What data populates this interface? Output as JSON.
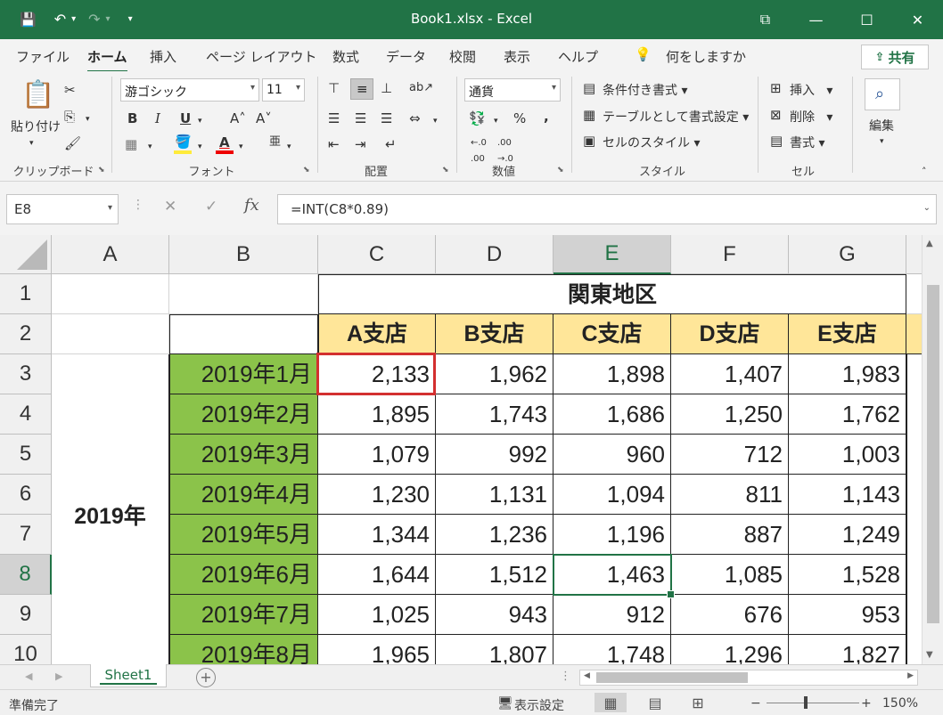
{
  "window": {
    "title": "Book1.xlsx - Excel",
    "controls": [
      "⧉",
      "—",
      "☐",
      "✕"
    ]
  },
  "qat": {
    "save": "💾",
    "undo": "↶",
    "redo": "↷",
    "more": "▾"
  },
  "tabs": [
    "ファイル",
    "ホーム",
    "挿入",
    "ページ レイアウト",
    "数式",
    "データ",
    "校閲",
    "表示",
    "ヘルプ"
  ],
  "active_tab": "ホーム",
  "tellme": "何をしますか",
  "share": "共有",
  "ribbon": {
    "clipboard": {
      "paste": "貼り付け",
      "group": "クリップボード"
    },
    "font": {
      "name": "游ゴシック",
      "size": "11",
      "bold": "B",
      "italic": "I",
      "underline": "U",
      "grow": "A˄",
      "shrink": "A˅",
      "group": "フォント"
    },
    "align": {
      "group": "配置"
    },
    "number": {
      "format": "通貨",
      "percent": "%",
      "comma": ",",
      "group": "数値"
    },
    "styles": {
      "cond": "条件付き書式",
      "table": "テーブルとして書式設定",
      "cell": "セルのスタイル",
      "group": "スタイル"
    },
    "cells": {
      "insert": "挿入",
      "delete": "削除",
      "format": "書式",
      "group": "セル"
    },
    "edit": {
      "label": "編集"
    }
  },
  "formula_bar": {
    "name_box": "E8",
    "formula": "=INT(C8*0.89)"
  },
  "columns": [
    "A",
    "B",
    "C",
    "D",
    "E",
    "F",
    "G"
  ],
  "rows": [
    "1",
    "2",
    "3",
    "4",
    "5",
    "6",
    "7",
    "8",
    "9",
    "10"
  ],
  "selected_col": "E",
  "selected_row": "8",
  "sheet": {
    "region": "関東地区",
    "branches": [
      "A支店",
      "B支店",
      "C支店",
      "D支店",
      "E支店"
    ],
    "year_label": "2019年",
    "months": [
      "2019年1月",
      "2019年2月",
      "2019年3月",
      "2019年4月",
      "2019年5月",
      "2019年6月",
      "2019年7月",
      "2019年8月"
    ],
    "values": [
      [
        "2,133",
        "1,962",
        "1,898",
        "1,407",
        "1,983"
      ],
      [
        "1,895",
        "1,743",
        "1,686",
        "1,250",
        "1,762"
      ],
      [
        "1,079",
        "992",
        "960",
        "712",
        "1,003"
      ],
      [
        "1,230",
        "1,131",
        "1,094",
        "811",
        "1,143"
      ],
      [
        "1,344",
        "1,236",
        "1,196",
        "887",
        "1,249"
      ],
      [
        "1,644",
        "1,512",
        "1,463",
        "1,085",
        "1,528"
      ],
      [
        "1,025",
        "943",
        "912",
        "676",
        "953"
      ],
      [
        "1,965",
        "1,807",
        "1,748",
        "1,296",
        "1,827"
      ]
    ]
  },
  "sheet_tabs": [
    "Sheet1"
  ],
  "status": {
    "ready": "準備完了",
    "display_settings": "表示設定",
    "zoom": "150%",
    "zoom_minus": "−",
    "zoom_plus": "+"
  },
  "colors": {
    "excel_green": "#217346",
    "header_fill": "#ffe699",
    "month_fill": "#8bc34a",
    "highlight": "#d32f2f"
  }
}
